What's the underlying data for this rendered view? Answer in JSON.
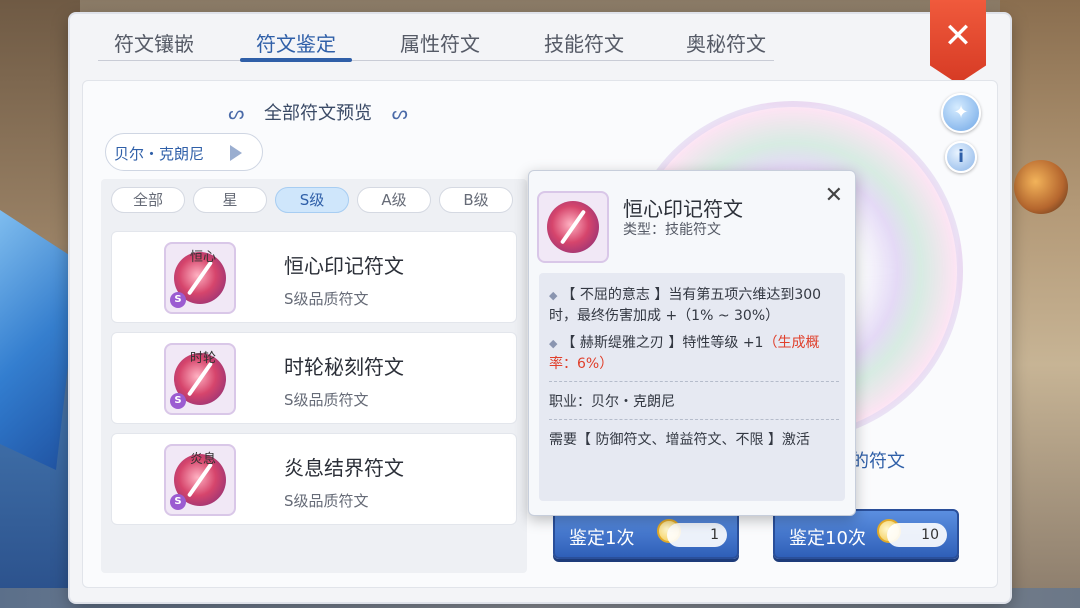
{
  "tabs": [
    {
      "label": "符文镶嵌"
    },
    {
      "label": "符文鉴定"
    },
    {
      "label": "属性符文"
    },
    {
      "label": "技能符文"
    },
    {
      "label": "奥秘符文"
    }
  ],
  "preview": {
    "title": "全部符文预览"
  },
  "character": {
    "name": "贝尔・克朗尼"
  },
  "filters": [
    {
      "label": "全部"
    },
    {
      "label": "星"
    },
    {
      "label": "S级"
    },
    {
      "label": "A级"
    },
    {
      "label": "B级"
    }
  ],
  "runes": [
    {
      "name": "恒心印记符文",
      "quality": "S级品质符文",
      "tag": "恒心",
      "grade": "S"
    },
    {
      "name": "时轮秘刻符文",
      "quality": "S级品质符文",
      "tag": "时轮",
      "grade": "S"
    },
    {
      "name": "炎息结界符文",
      "quality": "S级品质符文",
      "tag": "炎息",
      "grade": "S"
    }
  ],
  "right_panel": {
    "partial_text": "的符文"
  },
  "buttons": {
    "appraise_one": {
      "label": "鉴定1次",
      "count": "1"
    },
    "appraise_ten": {
      "label": "鉴定10次",
      "count": "10"
    }
  },
  "popup": {
    "title": "恒心印记符文",
    "type": "类型：技能符文",
    "effect1": "【 不屈的意志 】当有第五项六维达到300时，最终伤害加成 +（1% ~ 30%）",
    "effect2_main": "【 赫斯缇雅之刃 】特性等级 +1",
    "effect2_red": "（生成概率：6%）",
    "job": "职业：贝尔・克朗尼",
    "requirement": "需要【 防御符文、增益符文、不限 】激活"
  },
  "colors": {
    "accent_blue": "#2f5fa8",
    "close_red": "#e04a30",
    "grade_purple": "#9b5cd1",
    "highlight_red": "#e0402c"
  }
}
